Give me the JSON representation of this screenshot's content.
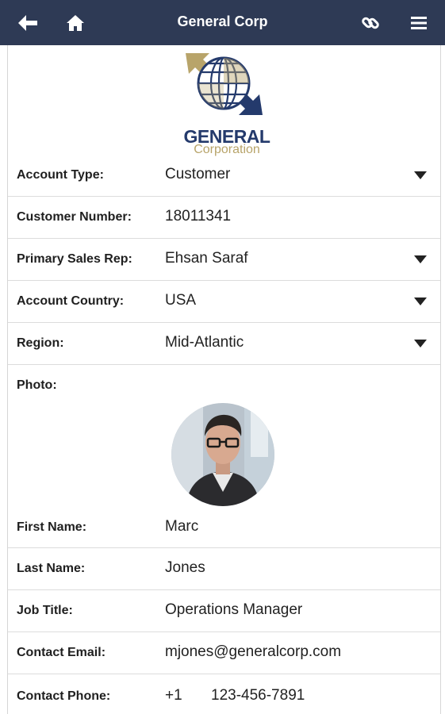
{
  "app": {
    "title": "General Corp"
  },
  "logo": {
    "line1": "GENERAL",
    "line2": "Corporation"
  },
  "fields": {
    "account_type": {
      "label": "Account Type:",
      "value": "Customer"
    },
    "customer_number": {
      "label": "Customer Number:",
      "value": "18011341"
    },
    "primary_sales_rep": {
      "label": "Primary Sales Rep:",
      "value": "Ehsan Saraf"
    },
    "account_country": {
      "label": "Account Country:",
      "value": "USA"
    },
    "region": {
      "label": "Region:",
      "value": "Mid-Atlantic"
    },
    "photo": {
      "label": "Photo:"
    },
    "first_name": {
      "label": "First Name:",
      "value": "Marc"
    },
    "last_name": {
      "label": "Last Name:",
      "value": "Jones"
    },
    "job_title": {
      "label": "Job Title:",
      "value": "Operations Manager"
    },
    "contact_email": {
      "label": "Contact Email:",
      "value": "mjones@generalcorp.com"
    },
    "contact_phone": {
      "label": "Contact Phone:",
      "country_code": "+1",
      "number": "123-456-7891"
    }
  },
  "icons": {
    "back": "back-arrow-icon",
    "home": "home-icon",
    "link": "link-icon",
    "menu": "hamburger-menu-icon",
    "dropdown": "caret-down-icon"
  },
  "colors": {
    "topbar": "#2e3a55",
    "logo_navy": "#243a6c",
    "logo_gold": "#b8a46a"
  }
}
